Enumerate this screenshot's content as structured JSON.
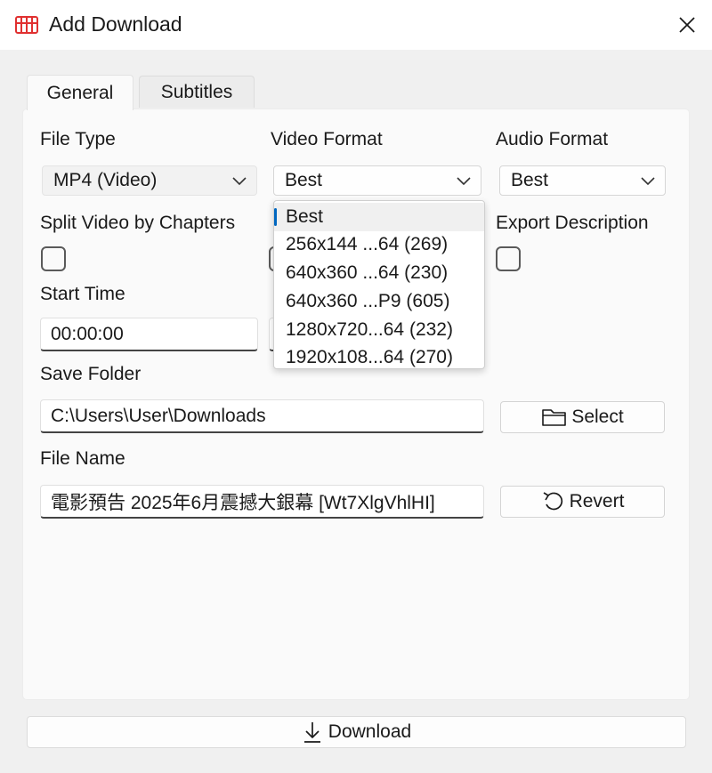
{
  "window": {
    "title": "Add Download",
    "icon": "app-logo-icon",
    "close_icon": "close-icon"
  },
  "tabs": [
    {
      "label": "General",
      "active": true
    },
    {
      "label": "Subtitles",
      "active": false
    }
  ],
  "general": {
    "file_type": {
      "label": "File Type",
      "value": "MP4 (Video)"
    },
    "video_format": {
      "label": "Video Format",
      "value": "Best",
      "options": [
        "Best",
        "256x144 ...64 (269)",
        "640x360 ...64 (230)",
        "640x360 ...P9 (605)",
        "1280x720...64 (232)",
        "1920x108...64 (270)"
      ],
      "selected_index": 0,
      "open": true
    },
    "audio_format": {
      "label": "Audio Format",
      "value": "Best"
    },
    "split_chapters": {
      "label": "Split Video by Chapters",
      "checked": false
    },
    "export_description": {
      "label": "Export Description",
      "checked": false
    },
    "start_time": {
      "label": "Start Time",
      "value": "00:00:00"
    },
    "save_folder": {
      "label": "Save Folder",
      "value": "C:\\Users\\User\\Downloads",
      "button_label": "Select",
      "button_icon": "folder-icon"
    },
    "file_name": {
      "label": "File Name",
      "value": "電影預告 2025年6月震撼大銀幕 [Wt7XlgVhlHI]",
      "button_label": "Revert",
      "button_icon": "undo-icon"
    }
  },
  "footer": {
    "download_label": "Download",
    "download_icon": "download-arrow-icon"
  },
  "colors": {
    "accent": "#0067c0",
    "app_icon": "#e03030"
  }
}
